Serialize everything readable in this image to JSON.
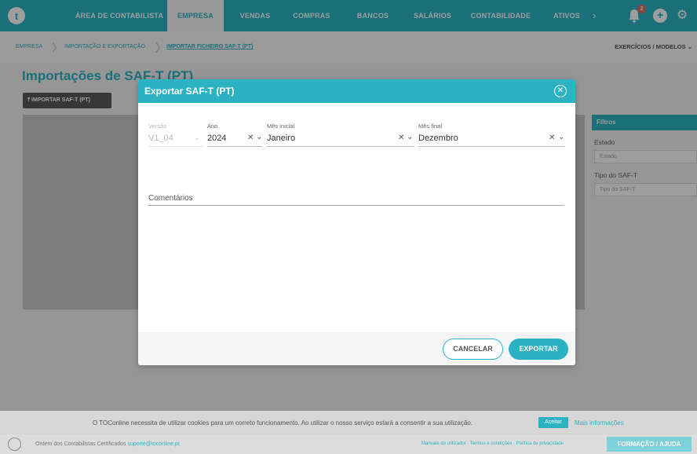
{
  "nav": {
    "items": [
      "ÁREA DE CONTABILISTA",
      "EMPRESA",
      "VENDAS",
      "COMPRAS",
      "BANCOS",
      "SALÁRIOS",
      "CONTABILIDADE",
      "ATIVOS"
    ],
    "active": "EMPRESA",
    "notifications": "2"
  },
  "breadcrumb": {
    "items": [
      "EMPRESA",
      "IMPORTAÇÃO E EXPORTAÇÃO",
      "IMPORTAR FICHEIRO SAF-T (PT)"
    ],
    "right": "EXERCÍCIOS / MODELOS"
  },
  "page": {
    "title": "Importações de SAF-T (PT)",
    "import_button": "IMPORTAR SAF-T (PT)"
  },
  "filters": {
    "title": "Filtros",
    "estado_label": "Estado",
    "estado_placeholder": "Estado",
    "tipo_label": "Tipo do SAF-T",
    "tipo_placeholder": "Tipo do SAF-T"
  },
  "modal": {
    "title": "Exportar SAF-T (PT)",
    "versao_label": "Versão",
    "versao_value": "V1_04",
    "ano_label": "Ano",
    "ano_value": "2024",
    "mes_inicial_label": "Mês inicial",
    "mes_inicial_value": "Janeiro",
    "mes_final_label": "Mês final",
    "mes_final_value": "Dezembro",
    "comentarios_label": "Comentários",
    "cancel_label": "CANCELAR",
    "export_label": "EXPORTAR"
  },
  "cookie": {
    "text": "O TOConline necessita de utilizar cookies para um correto funcionamento. Ao utilizar o nosso serviço estará a consentir a sua utilização.",
    "accept": "Aceitar",
    "more": "Mais informações"
  },
  "footer": {
    "org": "Ordem dos Contabilistas Certificados",
    "email": "suporte@toconline.pt",
    "links": "Manuais do utilizador · Termos e condições · Política de privacidade",
    "help": "FORMAÇÃO / AJUDA"
  }
}
